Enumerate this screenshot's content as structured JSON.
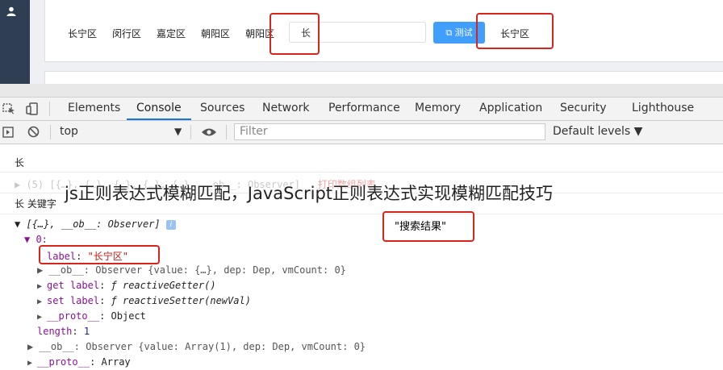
{
  "app": {
    "districts": [
      "长宁区",
      "闵行区",
      "嘉定区",
      "朝阳区",
      "朝阳区"
    ],
    "search_value": "长",
    "test_button_label": "测试",
    "test_button_icon": "external-link-icon",
    "result_text": "长宁区",
    "highlight_color": "#d9241b",
    "accent_color": "#409eff"
  },
  "devtools": {
    "tabs": [
      "Elements",
      "Console",
      "Sources",
      "Network",
      "Performance",
      "Memory",
      "Application",
      "Security",
      "Lighthouse"
    ],
    "active_tab": "Console",
    "context_select": "top",
    "filter_placeholder": "Filter",
    "levels_label": "Default levels ▼"
  },
  "console": {
    "line1": "长",
    "line2_prefix": "▶ (5) [{…}, {…}, {…}, {…}, {…}, __ob__: Observer]",
    "line2_note": "打印数组列表",
    "line3": "长 关键字",
    "line4": "▼ [{…}, __ob__: Observer]",
    "line5": "▼ 0:",
    "label_key": "label",
    "label_value": "\"长宁区\"",
    "ob_line": "▶ __ob__: Observer {value: {…}, dep: Dep, vmCount: 0}",
    "get_label_line_key": "get label",
    "get_label_line_val": "ƒ reactiveGetter()",
    "set_label_line_key": "set label",
    "set_label_line_val": "ƒ reactiveSetter(newVal)",
    "proto_line_key": "__proto__",
    "proto_line_val": "Object",
    "length_key": "length",
    "length_val": "1",
    "ob_line2": "▶ __ob__: Observer {value: Array(1), dep: Dep, vmCount: 0}",
    "proto2_key": "__proto__",
    "proto2_val": "Array",
    "annotation": "\"搜索结果\""
  },
  "watermark": "js正则表达式模糊匹配，JavaScript正则表达式实现模糊匹配技巧"
}
